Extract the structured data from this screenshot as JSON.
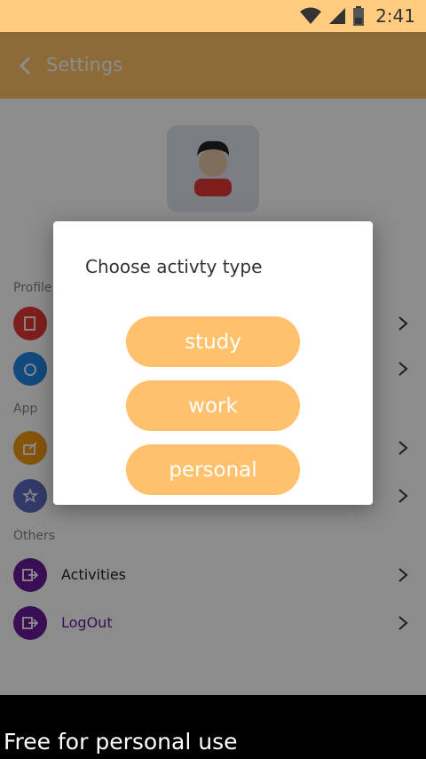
{
  "status": {
    "time": "2:41"
  },
  "header": {
    "title": "Settings"
  },
  "sections": {
    "profile": "Profile",
    "app": "App",
    "others": "Others"
  },
  "rows": {
    "activities": "Activities",
    "logout": "LogOut"
  },
  "dialog": {
    "title": "Choose activty type",
    "options": [
      "study",
      "work",
      "personal"
    ]
  },
  "watermark": "Free for personal use",
  "colors": {
    "status_bar": "#ffcc80",
    "app_bar": "#ffc368",
    "button": "#ffc16b",
    "purple": "#6a1b9a",
    "red": "#e53935",
    "blue": "#1e88e5",
    "orange": "#f29a14",
    "indigo": "#5c6bc0"
  },
  "icons": [
    "wifi-icon",
    "signal-icon",
    "battery-icon",
    "back-arrow-icon",
    "avatar-icon",
    "chevron-right-icon",
    "logout-icon"
  ]
}
